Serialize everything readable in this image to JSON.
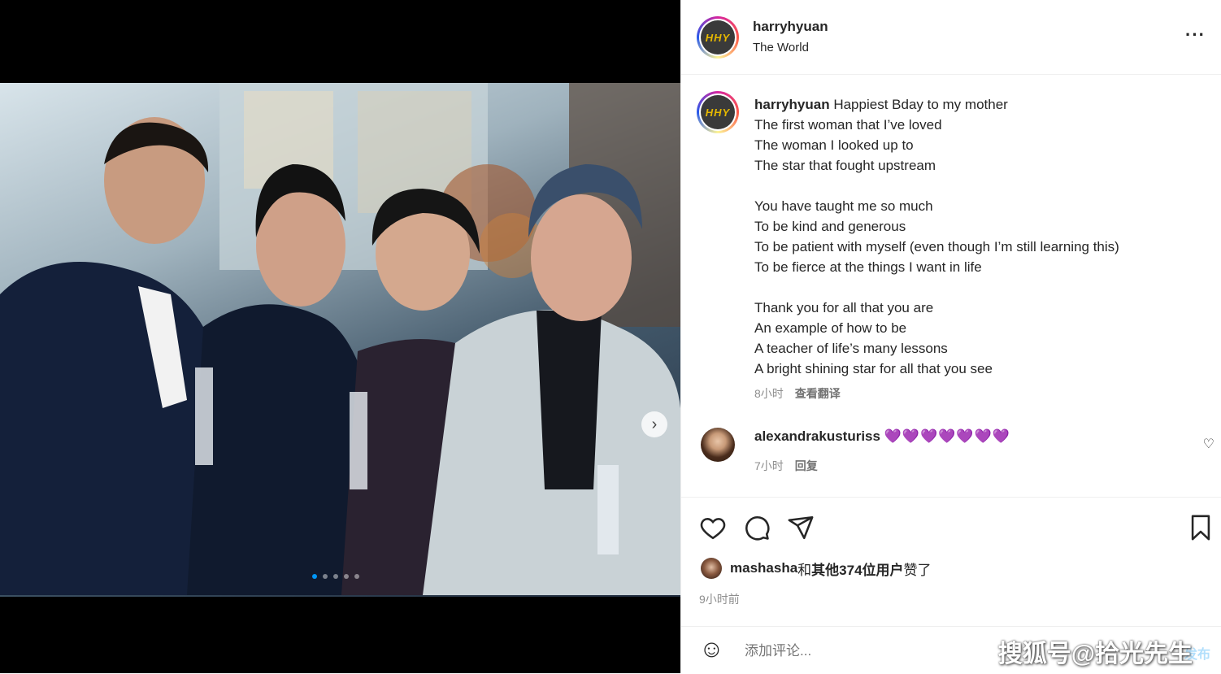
{
  "post": {
    "username": "harryhyuan",
    "location": "The World",
    "avatar_text": "HHY",
    "more_icon": "···",
    "carousel_next": "›",
    "carousel_dots": 5
  },
  "caption": {
    "username": "harryhyuan",
    "text": "Happiest Bday to my mother\nThe first woman that I’ve loved\nThe woman I looked up to\nThe star that fought upstream\n\nYou have taught me so much\nTo be kind and generous\nTo be patient with myself (even though I’m still learning this)\nTo be fierce at the things I want in life\n\nThank you for all that you are\nAn example of how to be\nA teacher of life’s many lessons\nA bright shining star for all that you see",
    "time": "8小时",
    "translate": "查看翻译"
  },
  "comment": {
    "username": "alexandrakusturiss",
    "text": "💜💜💜💜💜💜💜",
    "time": "7小时",
    "reply": "回复",
    "like_icon": "♡"
  },
  "likes": {
    "first_user": "mashasha",
    "connector": "和",
    "others": "其他374位用户",
    "suffix": "赞了"
  },
  "post_time": "9小时前",
  "comment_bar": {
    "placeholder": "添加评论...",
    "post_label": "发布",
    "emoji_icon": "☺"
  },
  "watermark": "搜狐号@拾光先生",
  "colors": {
    "accent": "#0095f6",
    "hearts": "#7e57c2",
    "muted": "#8e8e8e"
  }
}
